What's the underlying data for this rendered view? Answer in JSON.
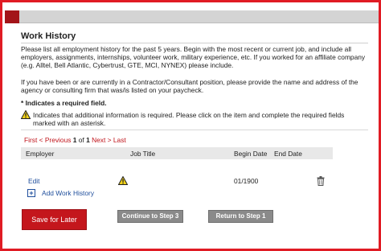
{
  "page": {
    "title": "Work History",
    "instructions_1": "Please list all employment history for the past 5 years. Begin with the most recent or current job, and include all employers, assignments, internships, volunteer work, military experience, etc. If you worked for an affiliate company (e.g. Alltel, Bell Atlantic, Cybertrust, GTE, MCI, NYNEX) please include.",
    "instructions_2": "If you have been or are currently in a Contractor/Consultant position, please provide the name and address of the agency or consulting firm that was/is listed on your paycheck.",
    "required_note": "* Indicates a required field.",
    "warning_note": "Indicates that additional information is required. Please click on the item and complete the required fields marked with an asterisk."
  },
  "pager": {
    "first": "First",
    "previous": "< Previous",
    "page_num": "1",
    "of_text": "of",
    "total": "1",
    "next": "Next",
    "next_arrow": ">",
    "last": "Last"
  },
  "grid": {
    "columns": [
      "Employer",
      "Job Title",
      "Begin Date",
      "End Date"
    ],
    "rows": [
      {
        "action": "Edit",
        "employer": "",
        "job_title": "",
        "begin_date": "01/1900",
        "end_date": ""
      }
    ]
  },
  "add_link": "Add Work History",
  "buttons": {
    "save": "Save for Later",
    "continue": "Continue to Step 3",
    "return": "Return to Step 1"
  },
  "colors": {
    "brand_red": "#c4161c",
    "link_blue": "#1f4e9c",
    "warning_yellow": "#f2d21a"
  },
  "icons": [
    "warning-icon",
    "trash-icon",
    "plus-icon"
  ]
}
